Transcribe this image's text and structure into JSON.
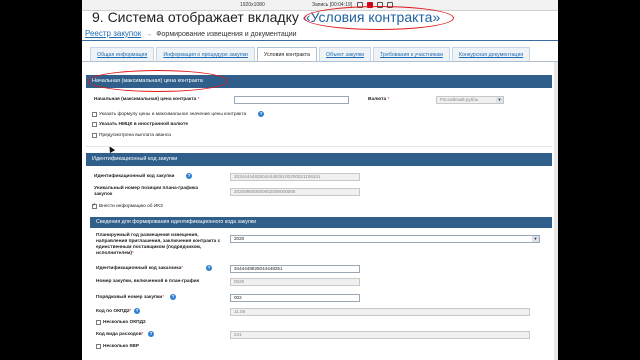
{
  "recorder": {
    "resolution": "1920x1080",
    "recording": "Запись [00:04:19]"
  },
  "slide": {
    "title_prefix": "9. Система отображает вкладку ",
    "title_highlight": "«Условия контракта»"
  },
  "breadcrumb": {
    "root": "Реестр закупок",
    "separator": "→",
    "current": "Формирование извещения и документации"
  },
  "tabs": [
    {
      "label": "Общая информация",
      "active": false
    },
    {
      "label": "Информация о процедуре закупки",
      "active": false
    },
    {
      "label": "Условия контракта",
      "active": true
    },
    {
      "label": "Объект закупки",
      "active": false
    },
    {
      "label": "Требования к участникам",
      "active": false
    },
    {
      "label": "Конкурсная документация",
      "active": false
    }
  ],
  "price_section": {
    "header": "Начальная (максимальная) цена контракта",
    "price_label": "Начальная (максимальная) цена контракта",
    "price_value": "",
    "currency_label": "Валюта",
    "currency_value": "Российский рубль",
    "formula_checkbox": "Указать формулу цены и максимальное значение цены контракта",
    "nmck_checkbox": "Указать НМЦК в иностранной валюте",
    "advance_checkbox": "Предусмотрена выплата аванса"
  },
  "ikz_section": {
    "header": "Идентификационный код закупки",
    "ikz_label": "Идентификационный код закупки",
    "ikz_value": "203444448250444482510020002110624​1",
    "position_label": "Уникальный номер позиции плана-графика закупок",
    "position_value": "202099500000002008000066",
    "manual_checkbox": "Внести информацию об ИКЗ"
  },
  "ikz_details": {
    "header": "Сведения для формирования идентификационного кода закупки",
    "year_label": "Планируемый год размещения извещения, направления приглашения, заключения контракта с единственным поставщиком (подрядчиком, исполнителем)",
    "year_value": "2020",
    "customer_label": "Идентификационный код заказчика",
    "customer_value": "3444448825044448251",
    "plan_number_label": "Номер закупки, включенной в план-график",
    "plan_number_value": "0020",
    "order_label": "Порядковый номер закупки",
    "order_value": "002",
    "okpd_label": "Код по ОКПД2",
    "okpd_value": "11.06",
    "several_okpd_label": "Несколько ОКПД2",
    "expense_label": "Код вида расходов",
    "expense_value": "241",
    "several_kvr_label": "Несколько КВР"
  },
  "colors": {
    "header_blue": "#2f5f8a",
    "link_blue": "#1f6cb0",
    "annotation_red": "#e0191b"
  }
}
